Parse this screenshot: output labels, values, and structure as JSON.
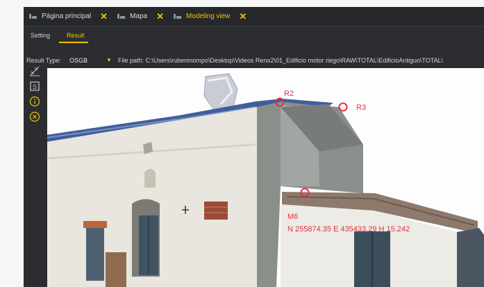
{
  "tabs": [
    {
      "label": "Página principal",
      "icon": "app-icon",
      "active": false
    },
    {
      "label": "Mapa",
      "icon": "app-icon",
      "active": false
    },
    {
      "label": "Modeling view",
      "icon": "app-icon",
      "active": true
    }
  ],
  "subtabs": {
    "setting": "Setting",
    "result": "Result",
    "active": "result"
  },
  "result_bar": {
    "result_type_label": "Result Type:",
    "result_type_value": "OSGB",
    "file_path": "File path: C:\\Users\\rubenmompo\\Desktop\\Videos Reno2\\01_Edificio motor riego\\RAW\\TOTAL\\EdificioAntiguo\\TOTAL\\"
  },
  "sidebar_tools": [
    "measure-icon",
    "s-box-icon",
    "info-icon",
    "close-circle-icon"
  ],
  "viewport": {
    "markers": [
      {
        "label": "R2"
      },
      {
        "label": "R3"
      },
      {
        "label": "M6",
        "coords": "N 255874.35 E 435433.29 H 15.242"
      }
    ]
  },
  "colors": {
    "accent": "#f2c400",
    "marker": "#e0323e",
    "panel": "#2b2d31"
  }
}
